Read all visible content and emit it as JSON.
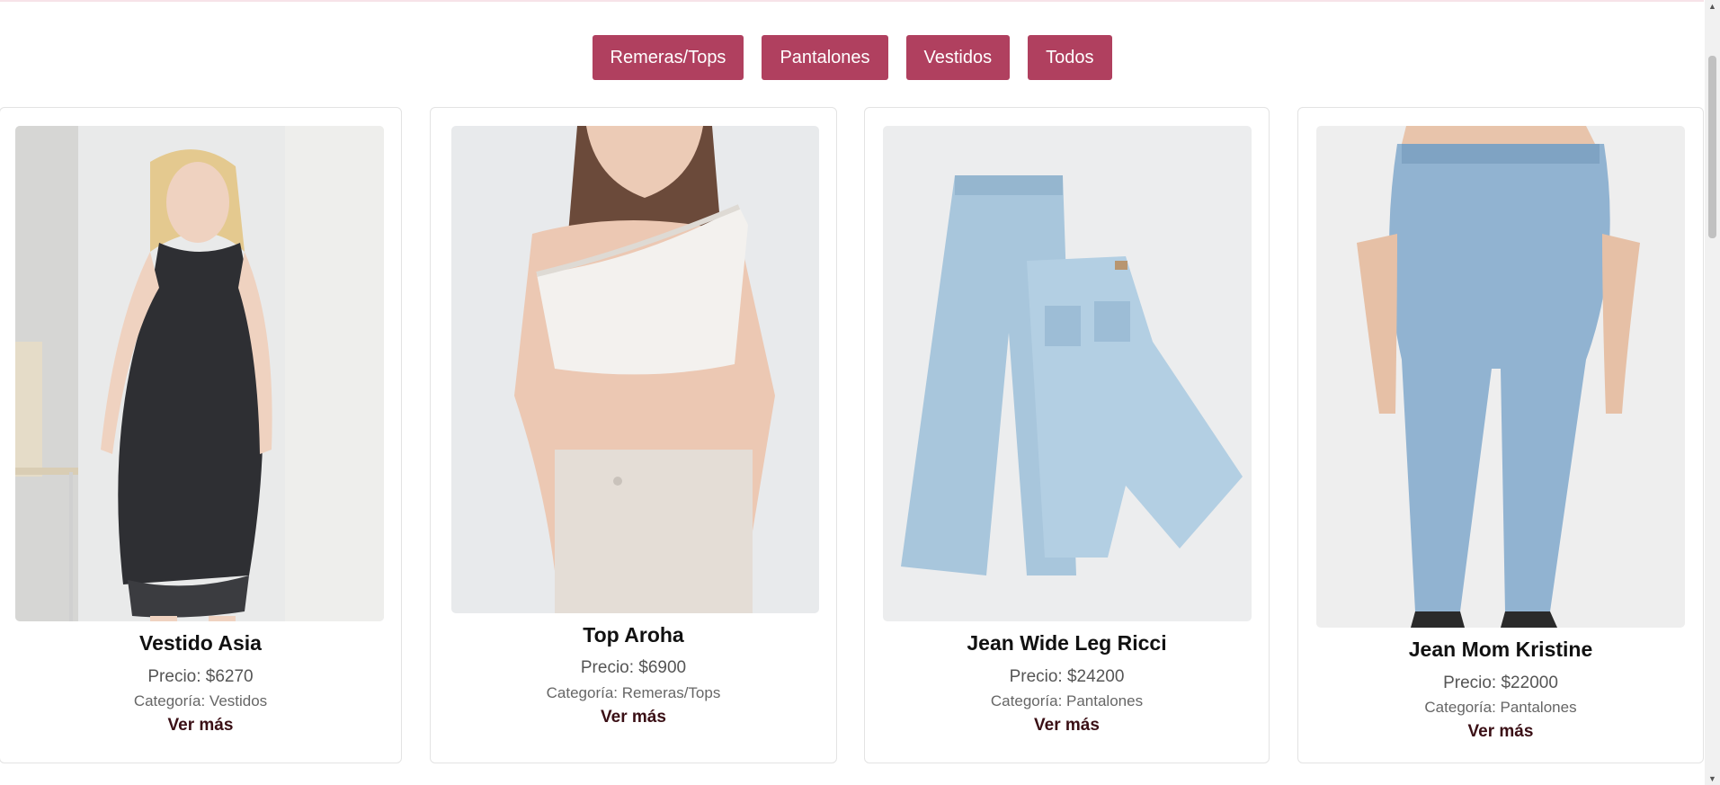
{
  "filters": [
    {
      "label": "Remeras/Tops"
    },
    {
      "label": "Pantalones"
    },
    {
      "label": "Vestidos"
    },
    {
      "label": "Todos"
    }
  ],
  "products": [
    {
      "name": "Vestido Asia",
      "price": "Precio: $6270",
      "category": "Categoría: Vestidos",
      "more": "Ver más"
    },
    {
      "name": "Top Aroha",
      "price": "Precio: $6900",
      "category": "Categoría: Remeras/Tops",
      "more": "Ver más"
    },
    {
      "name": "Jean Wide Leg Ricci",
      "price": "Precio: $24200",
      "category": "Categoría: Pantalones",
      "more": "Ver más"
    },
    {
      "name": "Jean Mom Kristine",
      "price": "Precio: $22000",
      "category": "Categoría: Pantalones",
      "more": "Ver más"
    }
  ],
  "colors": {
    "accent": "#b0405f",
    "link": "#3a0f15",
    "card_border": "#e3e3e3"
  },
  "icons": {
    "scroll_up": "scroll-up-arrow-icon",
    "scroll_down": "scroll-down-arrow-icon"
  }
}
